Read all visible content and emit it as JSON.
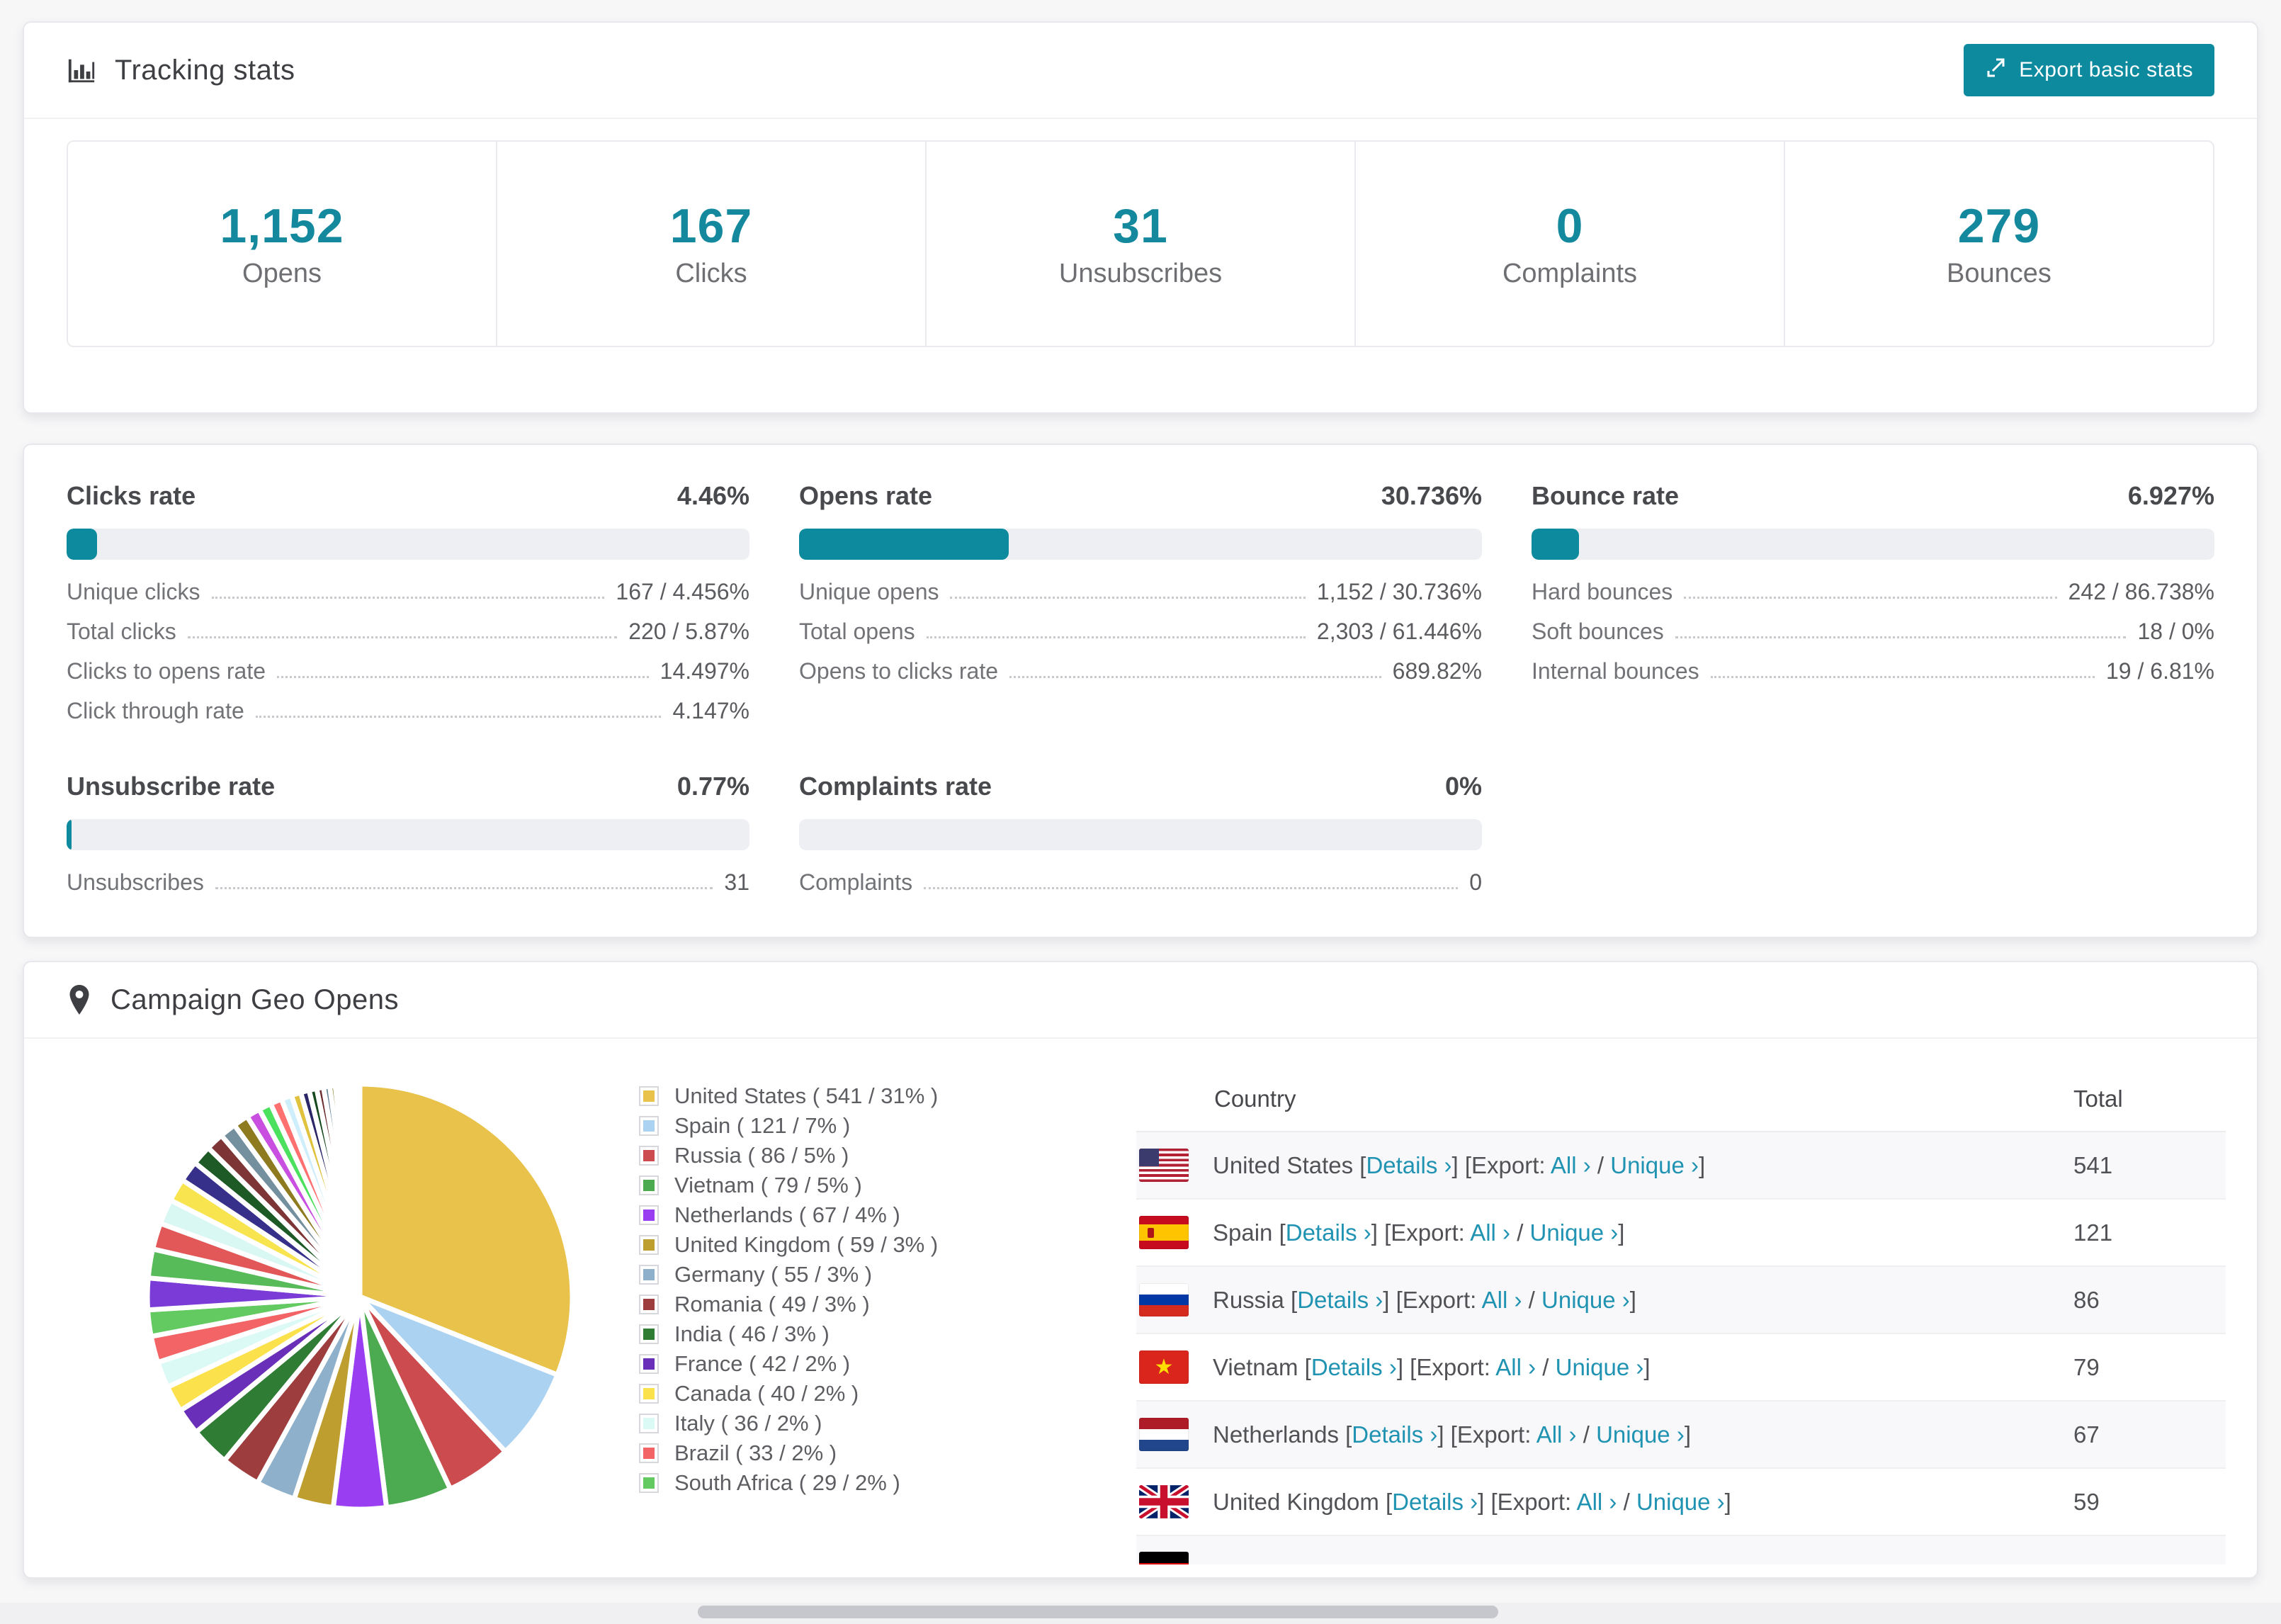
{
  "accent_color": "#0d8a9e",
  "link_color": "#2093b2",
  "icons": {
    "tracking": "bar-chart-icon",
    "export": "export-icon",
    "geo": "map-pin-icon"
  },
  "tracking": {
    "title": "Tracking stats",
    "export_button": "Export basic stats",
    "stats": [
      {
        "value": "1,152",
        "label": "Opens"
      },
      {
        "value": "167",
        "label": "Clicks"
      },
      {
        "value": "31",
        "label": "Unsubscribes"
      },
      {
        "value": "0",
        "label": "Complaints"
      },
      {
        "value": "279",
        "label": "Bounces"
      }
    ]
  },
  "rates": [
    {
      "id": "clicks-rate",
      "title": "Clicks rate",
      "value": "4.46%",
      "bar_pct": 4.46,
      "rows": [
        {
          "label": "Unique clicks",
          "value": "167 / 4.456%"
        },
        {
          "label": "Total clicks",
          "value": "220 / 5.87%"
        },
        {
          "label": "Clicks to opens rate",
          "value": "14.497%"
        },
        {
          "label": "Click through rate",
          "value": "4.147%"
        }
      ]
    },
    {
      "id": "opens-rate",
      "title": "Opens rate",
      "value": "30.736%",
      "bar_pct": 30.736,
      "rows": [
        {
          "label": "Unique opens",
          "value": "1,152 / 30.736%"
        },
        {
          "label": "Total opens",
          "value": "2,303 / 61.446%"
        },
        {
          "label": "Opens to clicks rate",
          "value": "689.82%"
        }
      ]
    },
    {
      "id": "bounce-rate",
      "title": "Bounce rate",
      "value": "6.927%",
      "bar_pct": 6.927,
      "rows": [
        {
          "label": "Hard bounces",
          "value": "242 / 86.738%"
        },
        {
          "label": "Soft bounces",
          "value": "18 / 0%"
        },
        {
          "label": "Internal bounces",
          "value": "19 / 6.81%"
        }
      ]
    },
    {
      "id": "unsubscribe-rate",
      "title": "Unsubscribe rate",
      "value": "0.77%",
      "bar_pct": 0.77,
      "rows": [
        {
          "label": "Unsubscribes",
          "value": "31"
        }
      ]
    },
    {
      "id": "complaints-rate",
      "title": "Complaints rate",
      "value": "0%",
      "bar_pct": 0,
      "rows": [
        {
          "label": "Complaints",
          "value": "0"
        }
      ]
    }
  ],
  "geo": {
    "title": "Campaign Geo Opens",
    "chart_data": {
      "type": "pie",
      "title": "Campaign Geo Opens",
      "legend_position": "right",
      "start_angle_deg": 0,
      "series": [
        {
          "name": "United States",
          "count": 541,
          "pct": 31,
          "color": "#e8c24a"
        },
        {
          "name": "Spain",
          "count": 121,
          "pct": 7,
          "color": "#abd2f1"
        },
        {
          "name": "Russia",
          "count": 86,
          "pct": 5,
          "color": "#cc4b4e"
        },
        {
          "name": "Vietnam",
          "count": 79,
          "pct": 5,
          "color": "#4cab50"
        },
        {
          "name": "Netherlands",
          "count": 67,
          "pct": 4,
          "color": "#9a3ef2"
        },
        {
          "name": "United Kingdom",
          "count": 59,
          "pct": 3,
          "color": "#bf9e30"
        },
        {
          "name": "Germany",
          "count": 55,
          "pct": 3,
          "color": "#8fb0ca"
        },
        {
          "name": "Romania",
          "count": 49,
          "pct": 3,
          "color": "#9e3d3d"
        },
        {
          "name": "India",
          "count": 46,
          "pct": 3,
          "color": "#2f7d35"
        },
        {
          "name": "France",
          "count": 42,
          "pct": 2,
          "color": "#6a2fb8"
        },
        {
          "name": "Canada",
          "count": 40,
          "pct": 2,
          "color": "#fbe14b"
        },
        {
          "name": "Italy",
          "count": 36,
          "pct": 2,
          "color": "#dcfaf5"
        },
        {
          "name": "Brazil",
          "count": 33,
          "pct": 2,
          "color": "#f26465"
        },
        {
          "name": "South Africa",
          "count": 29,
          "pct": 2,
          "color": "#63ca61"
        }
      ],
      "others": [
        {
          "pct": 2.4,
          "color": "#7a3bd6"
        },
        {
          "pct": 2.2,
          "color": "#56bb58"
        },
        {
          "pct": 2.0,
          "color": "#e25757"
        },
        {
          "pct": 1.9,
          "color": "#d9f8f4"
        },
        {
          "pct": 1.75,
          "color": "#f8e44e"
        },
        {
          "pct": 1.6,
          "color": "#36308a"
        },
        {
          "pct": 1.5,
          "color": "#1e5a26"
        },
        {
          "pct": 1.35,
          "color": "#7e3535"
        },
        {
          "pct": 1.25,
          "color": "#74909f"
        },
        {
          "pct": 1.15,
          "color": "#8f7b1f"
        },
        {
          "pct": 1.05,
          "color": "#c94fe0"
        },
        {
          "pct": 0.95,
          "color": "#4be05e"
        },
        {
          "pct": 0.88,
          "color": "#ff7070"
        },
        {
          "pct": 0.8,
          "color": "#cfeefc"
        },
        {
          "pct": 0.73,
          "color": "#e0c23f"
        },
        {
          "pct": 0.65,
          "color": "#2a2668"
        },
        {
          "pct": 0.58,
          "color": "#174a1e"
        },
        {
          "pct": 0.52,
          "color": "#6b2d2d"
        },
        {
          "pct": 0.47,
          "color": "#5f7f92"
        },
        {
          "pct": 0.42,
          "color": "#7c6b1a"
        },
        {
          "pct": 0.36,
          "color": "#b83fd6"
        },
        {
          "pct": 0.31,
          "color": "#3bd653"
        },
        {
          "pct": 0.26,
          "color": "#ff5c5c"
        },
        {
          "pct": 0.22,
          "color": "#bfe6fa"
        },
        {
          "pct": 0.18,
          "color": "#d4b83a"
        },
        {
          "pct": 0.15,
          "color": "#221f5e"
        },
        {
          "pct": 0.13,
          "color": "#123f18"
        },
        {
          "pct": 0.1,
          "color": "#5a2525"
        },
        {
          "pct": 0.08,
          "color": "#4f6e84"
        },
        {
          "pct": 0.06,
          "color": "#6a5c14"
        }
      ]
    },
    "table": {
      "headers": [
        "Country",
        "Total"
      ],
      "links": {
        "open": "[",
        "close": "]",
        "details": "Details",
        "export": "Export:",
        "all": "All",
        "unique": "Unique",
        "chevron": "›",
        "slash": "/"
      },
      "rows": [
        {
          "country": "United States",
          "flag": "us",
          "total": "541"
        },
        {
          "country": "Spain",
          "flag": "es",
          "total": "121"
        },
        {
          "country": "Russia",
          "flag": "ru",
          "total": "86"
        },
        {
          "country": "Vietnam",
          "flag": "vn",
          "total": "79"
        },
        {
          "country": "Netherlands",
          "flag": "nl",
          "total": "67"
        },
        {
          "country": "United Kingdom",
          "flag": "gb",
          "total": "59"
        }
      ],
      "partial_row": {
        "flag": "de"
      }
    }
  }
}
